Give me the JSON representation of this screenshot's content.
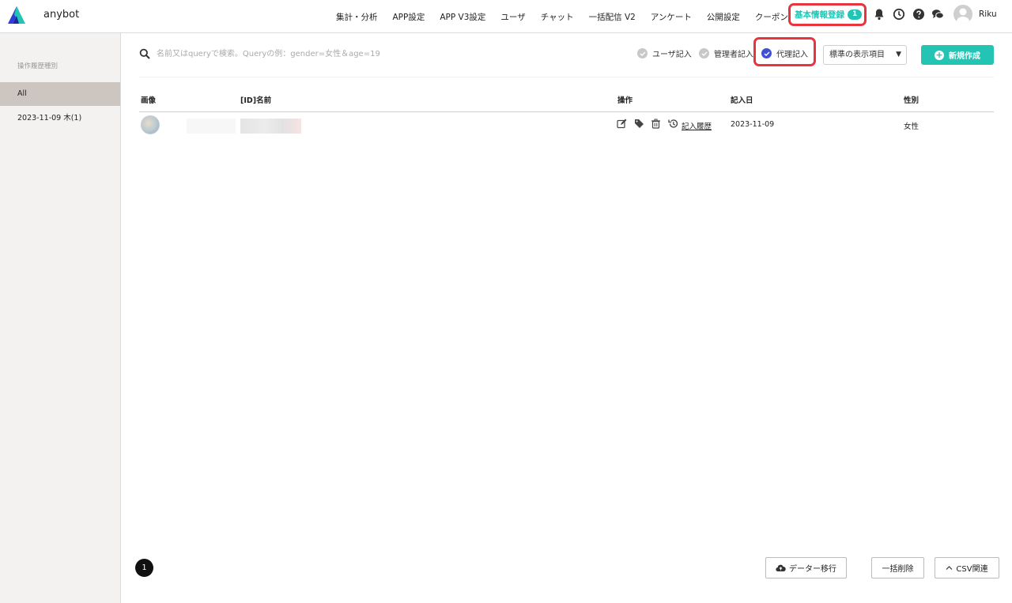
{
  "app": {
    "brand": "anybot",
    "logo_icon": "anybot-logo-icon"
  },
  "nav": {
    "items": [
      "集計・分析",
      "APP設定",
      "APP V3設定",
      "ユーザ",
      "チャット",
      "一括配信 V2",
      "アンケート",
      "公開設定",
      "クーポン"
    ],
    "active_label": "基本情報登録",
    "active_badge": "1",
    "icons": [
      "bell-icon",
      "clock-icon",
      "help-icon",
      "chat-icon"
    ],
    "user_name": "Riku"
  },
  "sidebar": {
    "heading": "操作履歴種別",
    "items": [
      {
        "label": "All",
        "active": true
      },
      {
        "label": "2023-11-09 木(1)",
        "active": false
      }
    ]
  },
  "search": {
    "placeholder": "名前又はqueryで検索。Queryの例：gender=女性＆age=19",
    "value": ""
  },
  "filters": {
    "options": [
      {
        "label": "ユーザ記入",
        "checked": false
      },
      {
        "label": "管理者記入",
        "checked": false
      },
      {
        "label": "代理記入",
        "checked": true
      }
    ]
  },
  "display_select": {
    "value": "標準の表示項目"
  },
  "new_button": {
    "label": "新規作成"
  },
  "table": {
    "headers": {
      "image": "画像",
      "name": "[ID]名前",
      "ops": "操作",
      "date": "記入日",
      "gender": "性別"
    },
    "rows": [
      {
        "history_link": "記入履歴",
        "date": "2023-11-09",
        "gender": "女性"
      }
    ]
  },
  "pagination": {
    "current": "1"
  },
  "bottom_buttons": {
    "data_migrate": "データー移行",
    "bulk_delete": "一括削除",
    "csv": "CSV関連"
  },
  "colors": {
    "accent": "#23c4b4",
    "highlight": "#e8343c",
    "radio_on": "#3f4fd8"
  }
}
